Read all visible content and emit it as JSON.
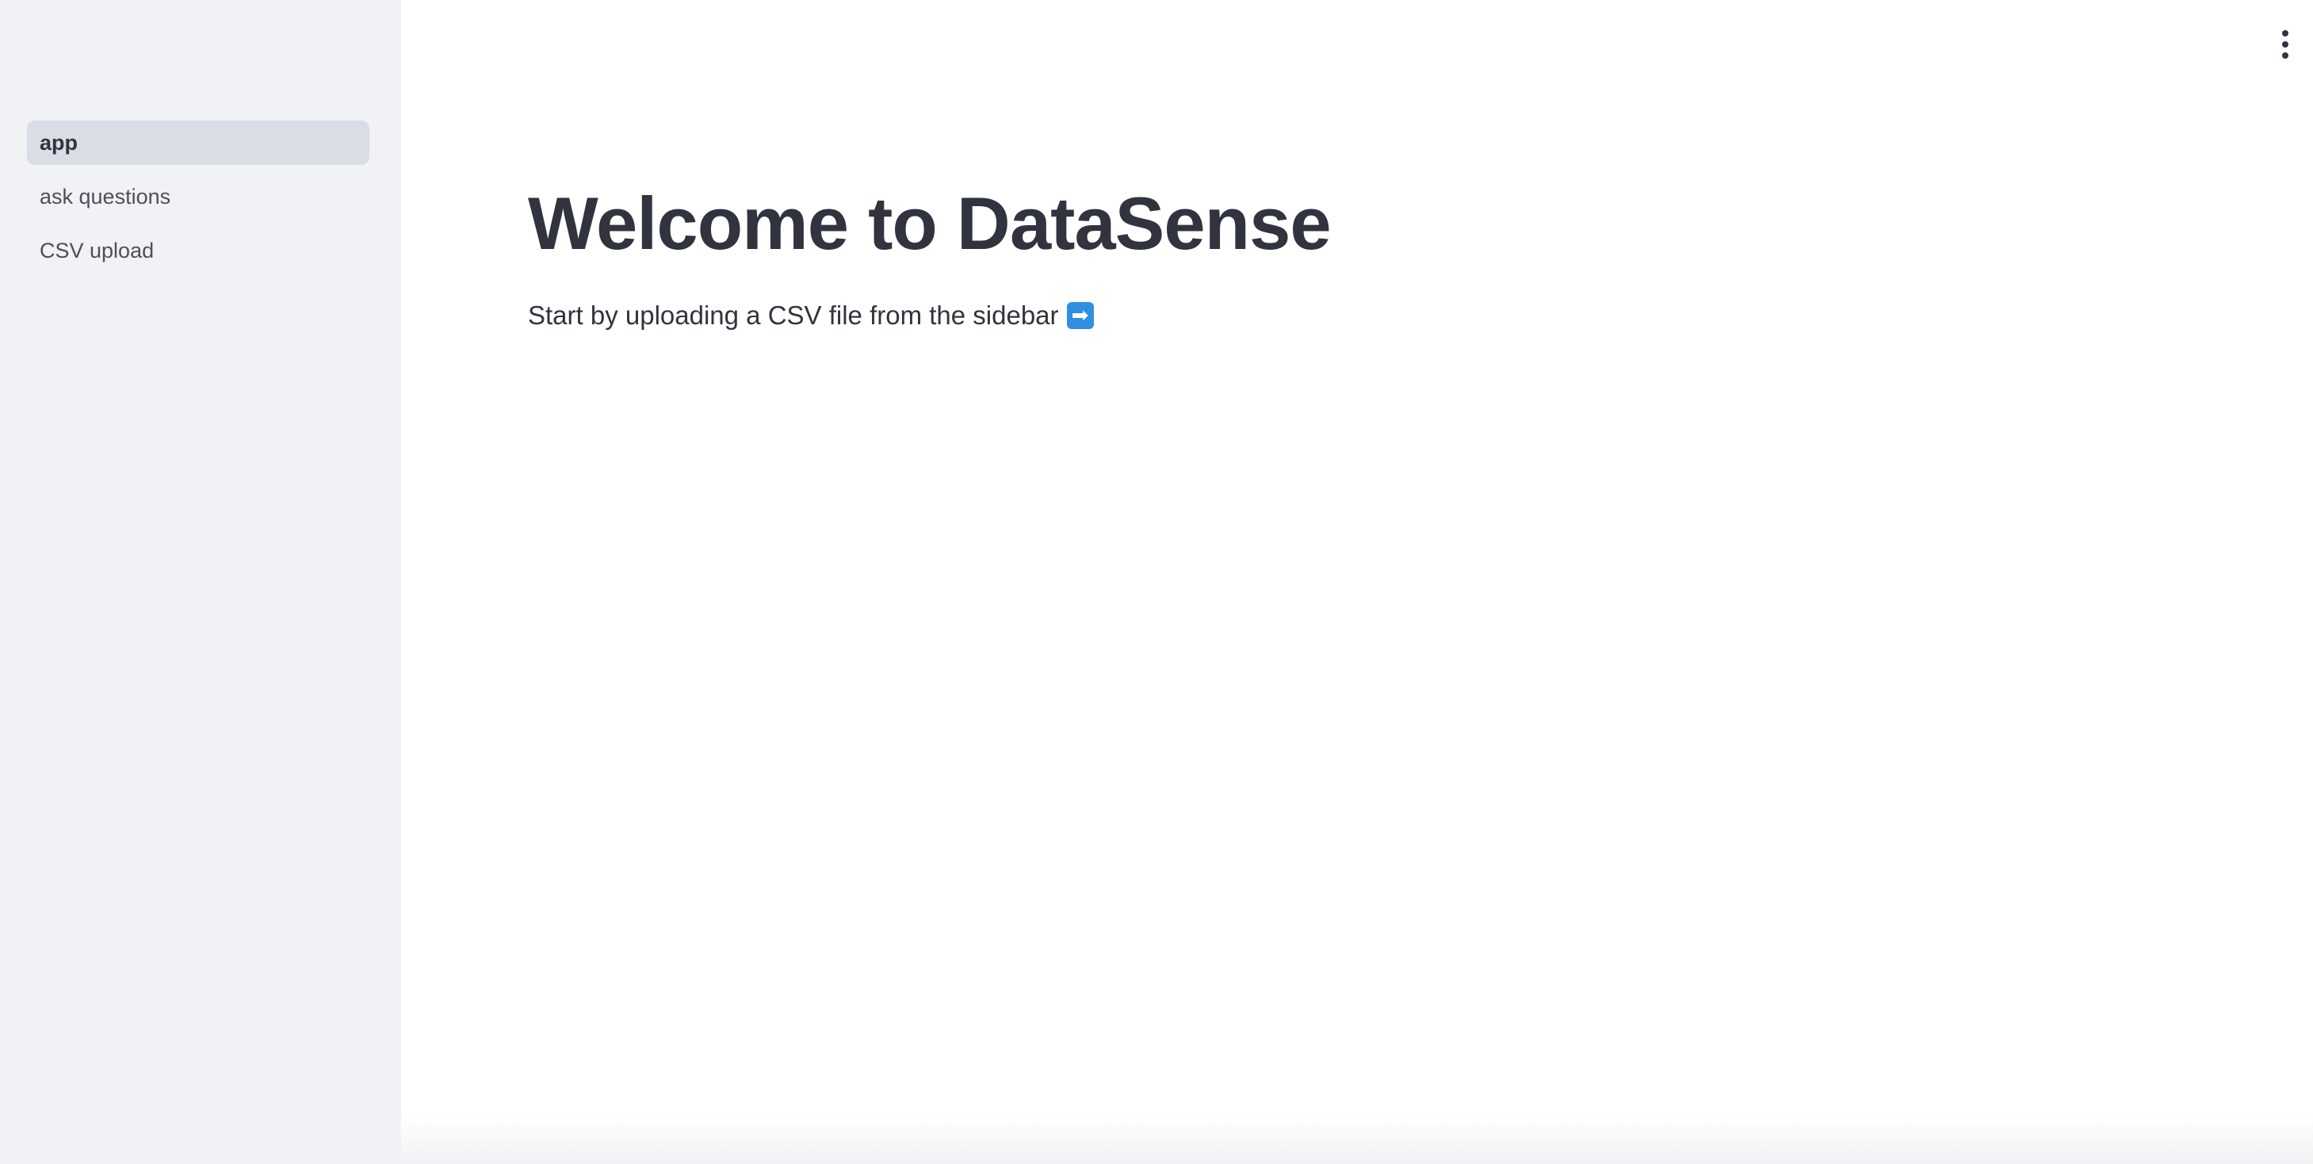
{
  "sidebar": {
    "items": [
      {
        "label": "app",
        "active": true
      },
      {
        "label": "ask questions",
        "active": false
      },
      {
        "label": "CSV upload",
        "active": false
      }
    ]
  },
  "header": {
    "menu_icon": "kebab-menu-icon"
  },
  "main": {
    "title": "Welcome to DataSense",
    "subtitle": "Start by uploading a CSV file from the sidebar",
    "subtitle_icon": "right-arrow-emoji-icon",
    "subtitle_icon_glyph": "➡"
  },
  "colors": {
    "sidebar_bg": "#f0f2f6",
    "active_item_bg": "#dadde6",
    "text": "#31333f",
    "arrow_icon_bg": "#2f8fe0"
  }
}
